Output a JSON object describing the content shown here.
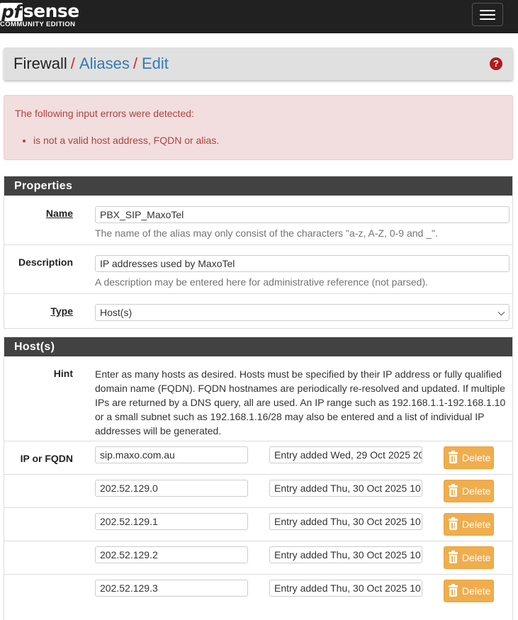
{
  "navbar": {
    "logo_text": "pfsense",
    "logo_pf": "pf",
    "logo_sense": "sense",
    "logo_edition": "COMMUNITY EDITION",
    "menu_icon": "hamburger-icon"
  },
  "breadcrumb": {
    "items": [
      "Firewall",
      "Aliases",
      "Edit"
    ],
    "separator": "/",
    "help_icon": "question-circle-icon",
    "help_glyph": "?"
  },
  "alert": {
    "heading": "The following input errors were detected:",
    "errors": [
      "is not a valid host address, FQDN or alias."
    ]
  },
  "properties": {
    "heading": "Properties",
    "name_label": "Name",
    "name_value": "PBX_SIP_MaxoTel",
    "name_help": "The name of the alias may only consist of the characters \"a-z, A-Z, 0-9 and _\".",
    "description_label": "Description",
    "description_value": "IP addresses used by MaxoTel",
    "description_help": "A description may be entered here for administrative reference (not parsed).",
    "type_label": "Type",
    "type_value": "Host(s)"
  },
  "hosts": {
    "heading": "Host(s)",
    "hint_label": "Hint",
    "hint_text": "Enter as many hosts as desired. Hosts must be specified by their IP address or fully qualified domain name (FQDN). FQDN hostnames are periodically re-resolved and updated. If multiple IPs are returned by a DNS query, all are used. An IP range such as 192.168.1.1-192.168.1.10 or a small subnet such as 192.168.1.16/28 may also be entered and a list of individual IP addresses will be generated.",
    "ip_label": "IP or FQDN",
    "delete_label": "Delete",
    "entries": [
      {
        "ip": "sip.maxo.com.au",
        "desc": "Entry added Wed, 29 Oct 2025 20"
      },
      {
        "ip": "202.52.129.0",
        "desc": "Entry added Thu, 30 Oct 2025 10"
      },
      {
        "ip": "202.52.129.1",
        "desc": "Entry added Thu, 30 Oct 2025 10"
      },
      {
        "ip": "202.52.129.2",
        "desc": "Entry added Thu, 30 Oct 2025 10"
      },
      {
        "ip": "202.52.129.3",
        "desc": "Entry added Thu, 30 Oct 2025 10"
      }
    ]
  }
}
